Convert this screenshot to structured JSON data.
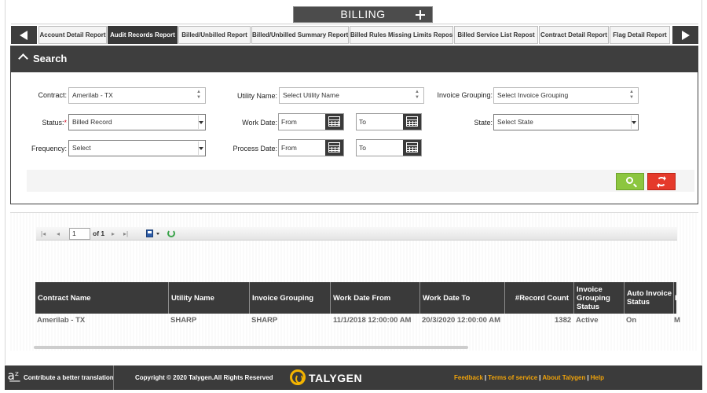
{
  "header": {
    "title": "BILLING",
    "add_icon": "plus-icon"
  },
  "tabs": [
    {
      "label": "Account Detail Report",
      "active": false
    },
    {
      "label": "Audit Records Report",
      "active": true
    },
    {
      "label": "Billed/Unbilled Report",
      "active": false
    },
    {
      "label": "Billed/Unbilled Summary Report",
      "active": false
    },
    {
      "label": "Billed Rules Missing Limits Repost",
      "active": false
    },
    {
      "label": "Billed Service List Repost",
      "active": false
    },
    {
      "label": "Contract Detail Report",
      "active": false
    },
    {
      "label": "Flag Detail Report",
      "active": false
    }
  ],
  "search": {
    "title": "Search",
    "fields": {
      "contract": {
        "label": "Contract:",
        "value": "Amerilab - TX"
      },
      "utility_name": {
        "label": "Utility Name:",
        "value": "Select Utility Name"
      },
      "invoice_grouping": {
        "label": "Invoice Grouping:",
        "value": "Select Invoice Grouping"
      },
      "status": {
        "label": "Status:",
        "required": "*",
        "value": "Billed Record"
      },
      "work_date": {
        "label": "Work Date:",
        "from": "From",
        "to": "To"
      },
      "state": {
        "label": "State:",
        "value": "Select State"
      },
      "frequency": {
        "label": "Frequency:",
        "value": "Select"
      },
      "process_date": {
        "label": "Process Date:",
        "from": "From",
        "to": "To"
      }
    },
    "colors": {
      "search_button": "#8cc63f",
      "reset_button": "#e53a2b"
    }
  },
  "pager": {
    "page": "1",
    "of_label": "of 1"
  },
  "table": {
    "headers": [
      "Contract Name",
      "Utility Name",
      "Invoice Grouping",
      "Work Date From",
      "Work Date To",
      "#Record Count",
      "Invoice Grouping Status",
      "Auto Invoice Status",
      "F"
    ],
    "rows": [
      [
        "Amerilab - TX",
        "SHARP",
        "SHARP",
        "11/1/2018 12:00:00 AM",
        "20/3/2020 12:00:00 AM",
        "1382",
        "Active",
        "On",
        "M"
      ]
    ]
  },
  "footer": {
    "translation": "Contribute a better translation",
    "copyright": "Copyright © 2020 Talygen.All Rights Reserved",
    "logo": "TALYGEN",
    "links": [
      "Feedback",
      "Terms of service",
      "About Talygen",
      "Help"
    ],
    "link_color": "#f0a30a"
  }
}
